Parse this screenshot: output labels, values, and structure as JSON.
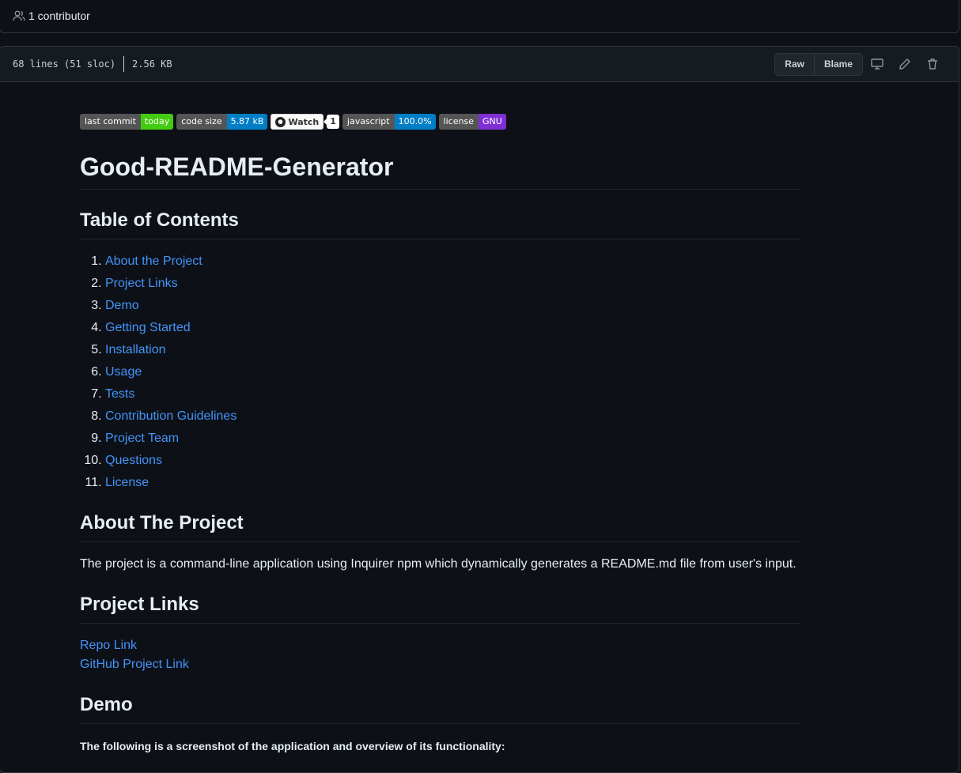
{
  "contributors": {
    "label": "1 contributor"
  },
  "file_header": {
    "lines": "68 lines (51 sloc)",
    "size": "2.56 KB",
    "raw": "Raw",
    "blame": "Blame"
  },
  "badges": [
    {
      "label": "last commit",
      "value": "today",
      "color": "#44cc11"
    },
    {
      "label": "code size",
      "value": "5.87 kB",
      "color": "#007ec6"
    },
    {
      "label": "javascript",
      "value": "100.0%",
      "color": "#007ec6"
    },
    {
      "label": "license",
      "value": "GNU",
      "color": "#7f2fd4"
    }
  ],
  "watch": {
    "label": "Watch",
    "count": "1"
  },
  "readme": {
    "title": "Good-README-Generator",
    "toc_heading": "Table of Contents",
    "toc": [
      "About the Project",
      "Project Links",
      "Demo",
      "Getting Started",
      "Installation",
      "Usage",
      "Tests",
      "Contribution Guidelines",
      "Project Team",
      "Questions",
      "License"
    ],
    "about_heading": "About The Project",
    "about_text": "The project is a command-line application using Inquirer npm which dynamically generates a README.md file from user's input.",
    "links_heading": "Project Links",
    "links": [
      "Repo Link",
      "GitHub Project Link"
    ],
    "demo_heading": "Demo",
    "demo_text": "The following is a screenshot of the application and overview of its functionality:"
  }
}
